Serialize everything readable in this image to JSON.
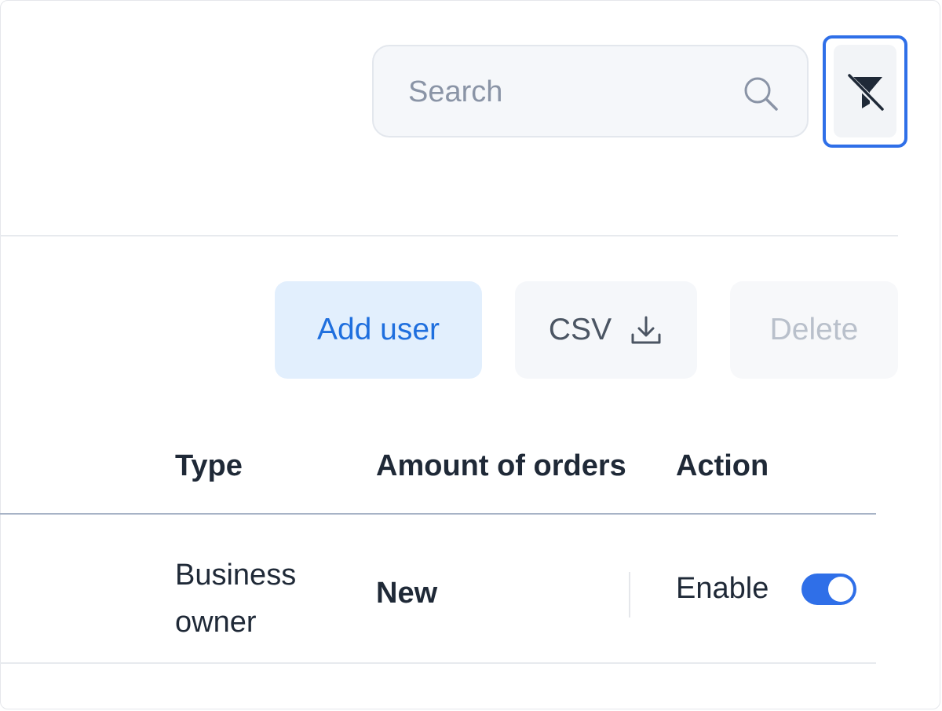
{
  "search": {
    "placeholder": "Search",
    "value": "",
    "icon": "search-icon"
  },
  "filter_button": {
    "icon": "filter-off-icon",
    "accent": "#2f6fe8"
  },
  "toolbar": {
    "add_user_label": "Add user",
    "csv_label": "CSV",
    "csv_icon": "download-icon",
    "delete_label": "Delete"
  },
  "table": {
    "columns": [
      "Type",
      "Amount of orders",
      "Action"
    ],
    "rows": [
      {
        "type": "Business owner",
        "amount_of_orders": "New",
        "action_label": "Enable",
        "action_enabled": true
      }
    ]
  },
  "colors": {
    "primary": "#2f6fe8",
    "add_user_bg": "#e2effd",
    "add_user_text": "#1f6fde",
    "text": "#1f2937",
    "muted_text": "#b9c0cb"
  }
}
